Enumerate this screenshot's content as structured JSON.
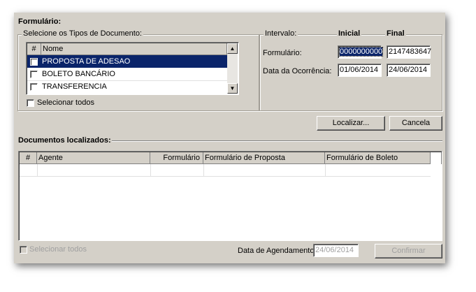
{
  "title": "Formulário:",
  "doc_types": {
    "legend": "Selecione os Tipos de Documento:",
    "header_hash": "#",
    "header_name": "Nome",
    "items": [
      {
        "label": "PROPOSTA DE ADESAO",
        "selected": true
      },
      {
        "label": "BOLETO BANCÁRIO",
        "selected": false
      },
      {
        "label": "TRANSFERENCIA",
        "selected": false
      }
    ],
    "select_all": "Selecionar todos"
  },
  "interval": {
    "legend": "Intervalo:",
    "col_initial": "Inicial",
    "col_final": "Final",
    "row_form_label": "Formulário:",
    "form_initial": "0000000000",
    "form_final": "2147483647",
    "row_date_label": "Data da Ocorrência:",
    "date_initial": "01/06/2014",
    "date_final": "24/06/2014"
  },
  "buttons": {
    "search": "Localizar...",
    "cancel": "Cancela",
    "confirm": "Confirmar"
  },
  "found": {
    "title": "Documentos localizados:",
    "columns": [
      "#",
      "Agente",
      "Formulário",
      "Formulário de Proposta",
      "Formulário de Boleto"
    ],
    "select_all": "Selecionar todos"
  },
  "schedule": {
    "label": "Data de Agendamento:",
    "value": "24/06/2014"
  }
}
